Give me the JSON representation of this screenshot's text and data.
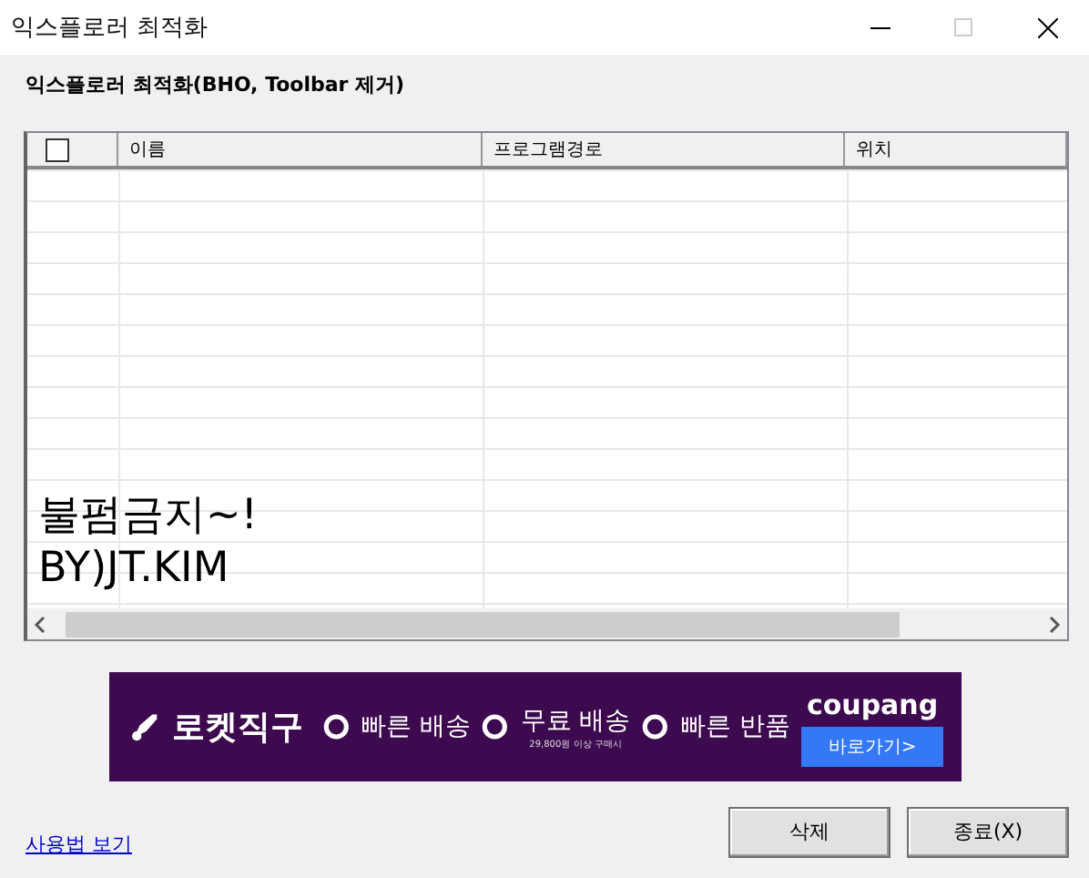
{
  "window": {
    "title": "익스플로러 최적화"
  },
  "heading": "익스플로러 최적화(BHO, Toolbar 제거)",
  "table": {
    "select_all": {
      "checked": false
    },
    "columns": [
      "이름",
      "프로그램경로",
      "위치"
    ]
  },
  "overlay_lines": [
    "불펌금지~!",
    "BY)JT.KIM"
  ],
  "ad": {
    "brand_title": "로켓직구",
    "features": [
      {
        "label": "빠른 배송"
      },
      {
        "label": "무료 배송",
        "note": "29,800원 이상 구매시"
      },
      {
        "label": "빠른 반품"
      }
    ],
    "logo": "coupang",
    "cta": "바로가기>"
  },
  "help_link": "사용법 보기",
  "buttons": [
    "삭제",
    "종료(X)"
  ]
}
